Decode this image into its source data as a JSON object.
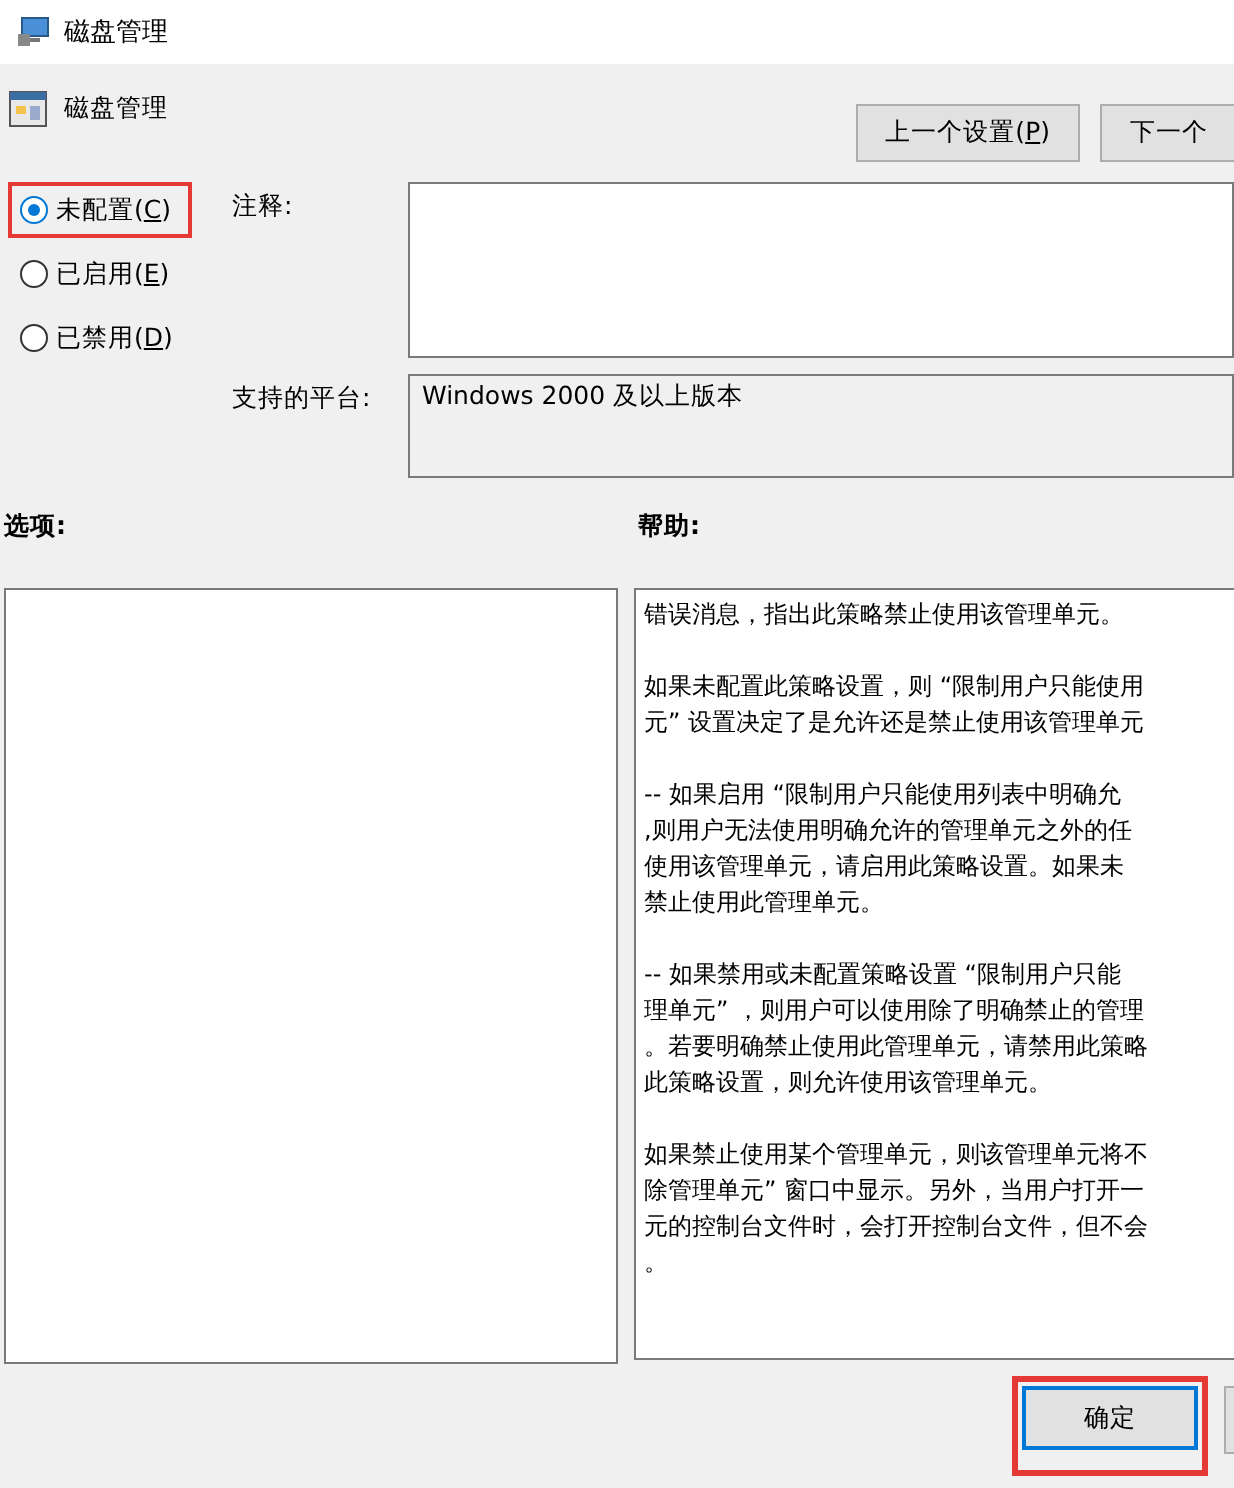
{
  "window": {
    "title": "磁盘管理"
  },
  "policy": {
    "name": "磁盘管理"
  },
  "nav_buttons": [
    {
      "before": "上一个设置(",
      "key": "P",
      "after": ")"
    },
    {
      "before": "下一个"
    }
  ],
  "state_options": [
    {
      "before": "未配置(",
      "key": "C",
      "after": ")",
      "selected": true,
      "highlighted": true
    },
    {
      "before": "已启用(",
      "key": "E",
      "after": ")",
      "selected": false,
      "highlighted": false
    },
    {
      "before": "已禁用(",
      "key": "D",
      "after": ")",
      "selected": false,
      "highlighted": false
    }
  ],
  "comment": {
    "label": "注释:"
  },
  "platform": {
    "label": "支持的平台:",
    "value": "Windows 2000 及以上版本"
  },
  "options": {
    "label": "选项:"
  },
  "help": {
    "label": "帮助:",
    "paragraphs": [
      [
        "错误消息，指出此策略禁止使用该管理单元。"
      ],
      [
        "如果未配置此策略设置，则 “限制用户只能使用",
        "元” 设置决定了是允许还是禁止使用该管理单元"
      ],
      [
        "-- 如果启用 “限制用户只能使用列表中明确允",
        ",则用户无法使用明确允许的管理单元之外的任",
        "使用该管理单元，请启用此策略设置。如果未",
        "禁止使用此管理单元。"
      ],
      [
        "-- 如果禁用或未配置策略设置 “限制用户只能",
        "理单元” ，则用户可以使用除了明确禁止的管理",
        "。若要明确禁止使用此管理单元，请禁用此策略",
        "此策略设置，则允许使用该管理单元。"
      ],
      [
        "如果禁止使用某个管理单元，则该管理单元将不",
        "除管理单元” 窗口中显示。另外，当用户打开一",
        "元的控制台文件时，会打开控制台文件，但不会",
        "。"
      ]
    ]
  },
  "footer_buttons": [
    {
      "label": "确定",
      "highlighted": true,
      "default": true
    }
  ]
}
